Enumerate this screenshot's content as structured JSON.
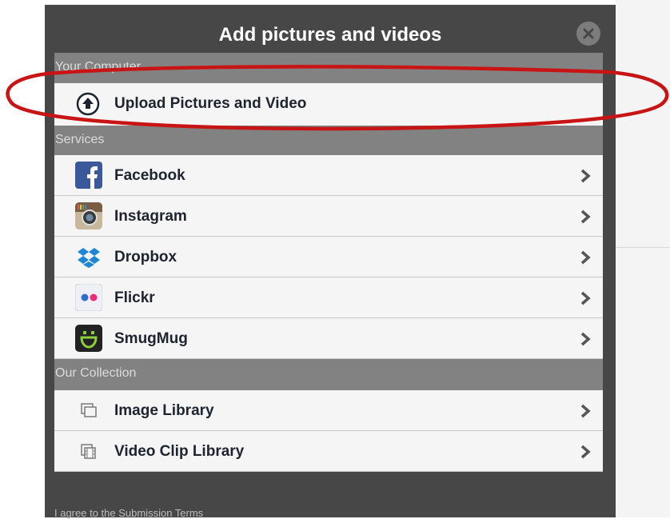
{
  "dialog": {
    "title": "Add pictures and videos",
    "close_icon": "close-circle-icon"
  },
  "sections": {
    "computer": {
      "header": "Your Computer",
      "upload_label": "Upload Pictures and Video",
      "upload_icon": "upload-arrow-icon"
    },
    "services": {
      "header": "Services",
      "items": [
        {
          "label": "Facebook",
          "icon": "facebook-icon"
        },
        {
          "label": "Instagram",
          "icon": "instagram-icon"
        },
        {
          "label": "Dropbox",
          "icon": "dropbox-icon"
        },
        {
          "label": "Flickr",
          "icon": "flickr-icon"
        },
        {
          "label": "SmugMug",
          "icon": "smugmug-icon"
        }
      ]
    },
    "collection": {
      "header": "Our Collection",
      "items": [
        {
          "label": "Image Library",
          "icon": "image-library-icon"
        },
        {
          "label": "Video Clip Library",
          "icon": "video-library-icon"
        }
      ]
    }
  },
  "footer": {
    "terms_text": "I agree to the Submission Terms"
  },
  "colors": {
    "modal_bg": "#474747",
    "section_header_bg": "#828282",
    "row_bg": "#f5f5f5",
    "annotation_red": "#c81414"
  }
}
